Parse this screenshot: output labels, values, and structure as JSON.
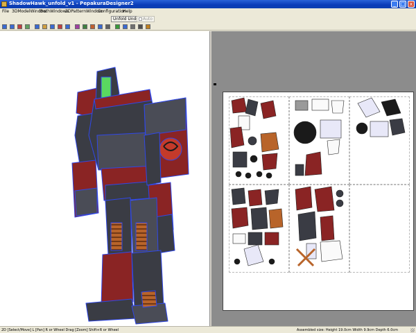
{
  "window": {
    "title": "ShadowHawk_unfold_v1 - PepakuraDesigner2",
    "minimize": "_",
    "maximize": "□",
    "close": "x"
  },
  "menu": {
    "items": [
      "File",
      "3DModelWindow",
      "BothWindows",
      "2DPatternWindow",
      "Configuration",
      "Help"
    ]
  },
  "toolbar": {
    "unfold_undo_label": "Unfold Undo",
    "auto_label": "Auto"
  },
  "tools": [
    {
      "icon": "select-icon",
      "color": "#3a6ad0"
    },
    {
      "icon": "fit-icon",
      "color": "#3a6ad0"
    },
    {
      "icon": "edit-icon",
      "color": "#c04040"
    },
    {
      "icon": "paint-icon",
      "color": "#60a060"
    },
    {
      "icon": "rotate-icon",
      "color": "#3a6ad0"
    },
    {
      "icon": "texture-icon",
      "color": "#d0a040"
    },
    {
      "icon": "view-icon",
      "color": "#3a6ad0"
    },
    {
      "icon": "unfold-icon",
      "color": "#c04040"
    },
    {
      "icon": "join-icon",
      "color": "#3a6ad0"
    },
    {
      "icon": "cut-icon",
      "color": "#a040a0"
    },
    {
      "icon": "arrange-icon",
      "color": "#408040"
    },
    {
      "icon": "fold-icon",
      "color": "#c06030"
    },
    {
      "icon": "flap-icon",
      "color": "#3a6ad0"
    },
    {
      "icon": "text-icon",
      "color": "#606060"
    },
    {
      "icon": "image-icon",
      "color": "#3a9a3a"
    },
    {
      "icon": "grid-icon",
      "color": "#3a6ad0"
    },
    {
      "icon": "camera-icon",
      "color": "#707070"
    },
    {
      "icon": "print-icon",
      "color": "#505050"
    },
    {
      "icon": "settings-icon",
      "color": "#c08020"
    }
  ],
  "status": {
    "left": "2D [Select/Move] L [Pan] R or Wheel Drag [Zoom] Shift+R or Wheel",
    "right": "Assembled size: Height 19.0cm Width 9.9cm Depth 6.0cm"
  },
  "colors": {
    "robot_dark": "#3a3c44",
    "robot_red": "#8a2424",
    "robot_edge": "#3048e8",
    "robot_green": "#5ad860",
    "part_orange": "#b8642a"
  }
}
